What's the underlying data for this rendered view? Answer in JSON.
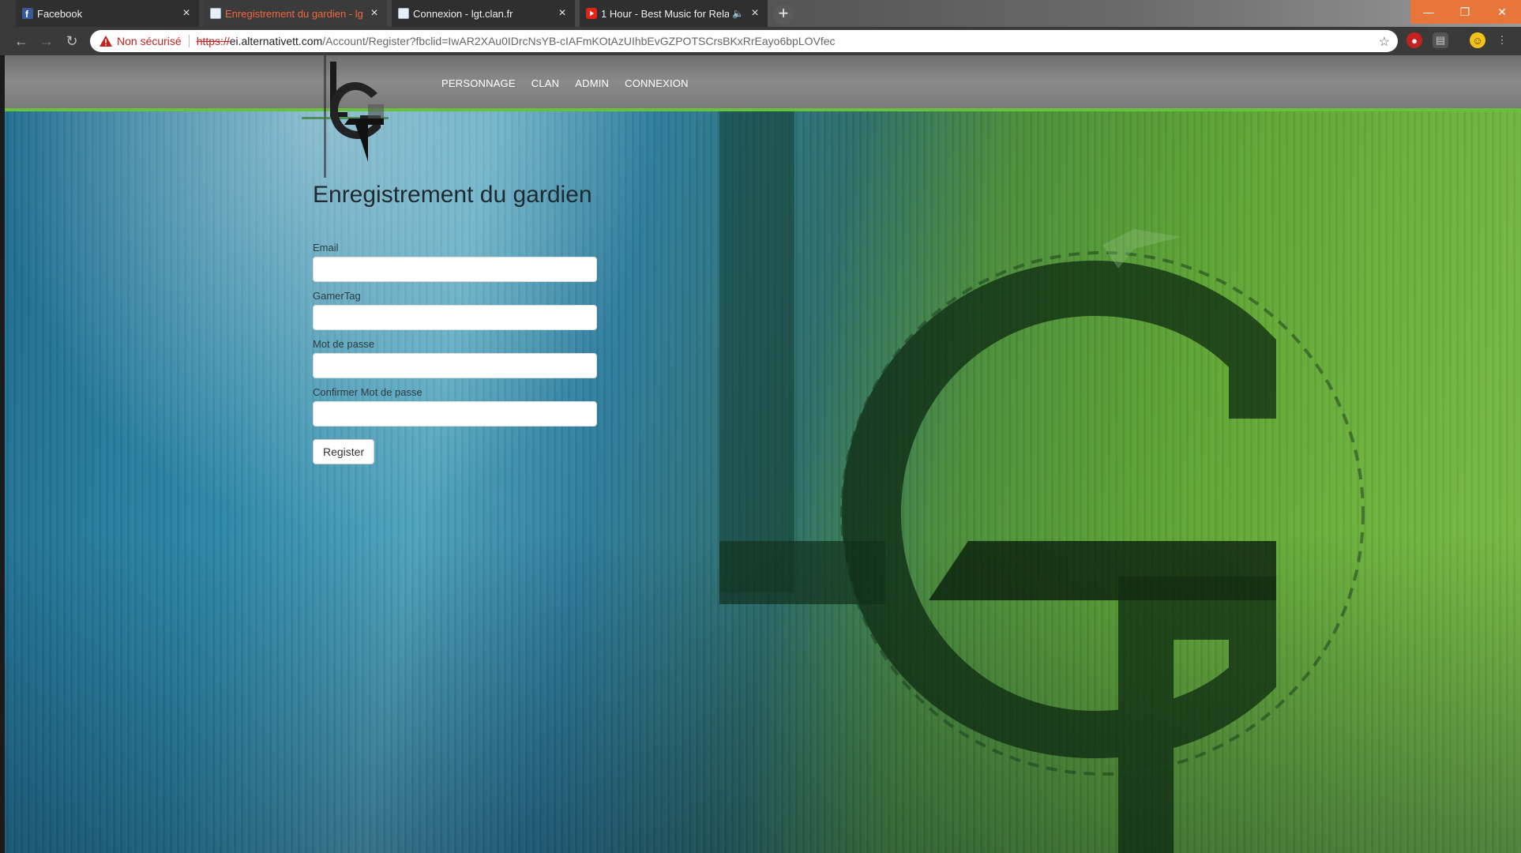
{
  "browser": {
    "tabs": [
      {
        "title": "Facebook",
        "icon": "facebook-icon",
        "state": "inactive"
      },
      {
        "title": "Enregistrement du gardien - lgt.",
        "icon": "page-icon",
        "state": "active"
      },
      {
        "title": "Connexion - lgt.clan.fr",
        "icon": "page-icon",
        "state": "inactive"
      },
      {
        "title": "1 Hour - Best Music for Rela",
        "icon": "youtube-icon",
        "state": "inactive",
        "audio": true
      }
    ],
    "security_label": "Non sécurisé",
    "url": {
      "scheme": "https://",
      "host": "ei.alternativett.com",
      "path": "/Account/Register?fbclid=IwAR2XAu0IDrcNsYB-cIAFmKOtAzUIhbEvGZPOTSCrsBKxRrEayo6bpLOVfec"
    }
  },
  "site": {
    "logo_text": "LGT",
    "nav": [
      "PERSONNAGE",
      "CLAN",
      "ADMIN",
      "CONNEXION"
    ]
  },
  "form": {
    "title": "Enregistrement du gardien",
    "email_label": "Email",
    "email_value": "",
    "gamertag_label": "GamerTag",
    "gamertag_value": "",
    "password_label": "Mot de passe",
    "password_value": "",
    "confirm_label": "Confirmer Mot de passe",
    "confirm_value": "",
    "submit_label": "Register"
  },
  "colors": {
    "accent_green": "#6abf3c",
    "active_tab_text": "#f0663e",
    "insecure_red": "#c5221f",
    "window_controls": "#e8763a"
  }
}
